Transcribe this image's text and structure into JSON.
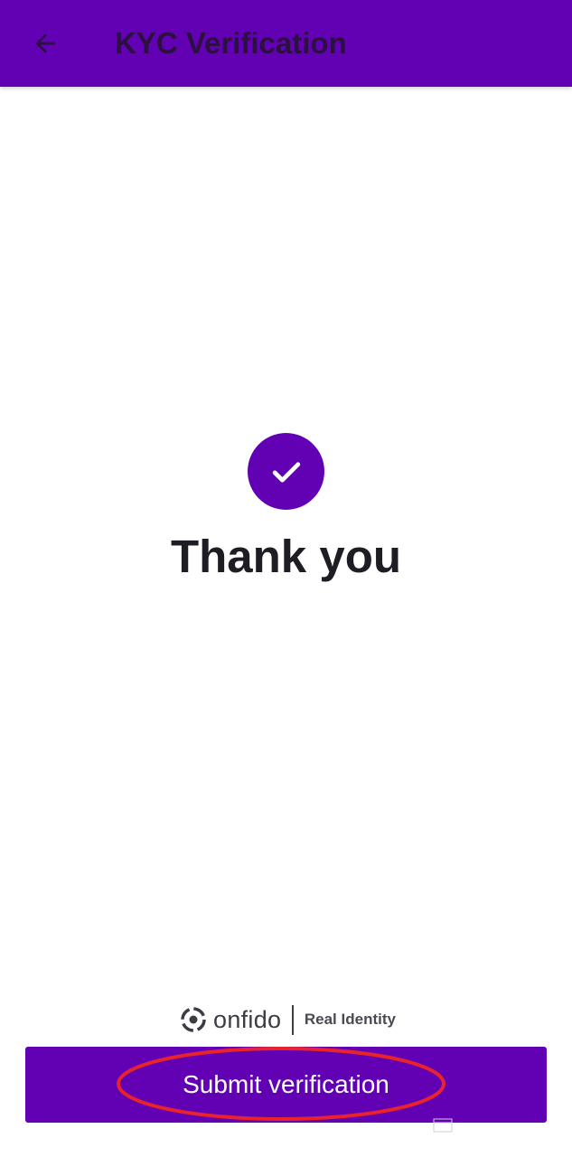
{
  "header": {
    "title": "KYC Verification",
    "back_icon": "arrow-left-icon"
  },
  "main": {
    "status_icon": "checkmark-icon",
    "message": "Thank you"
  },
  "branding": {
    "logo_icon": "onfido-logo-icon",
    "name": "onfido",
    "tagline": "Real Identity"
  },
  "footer": {
    "submit_label": "Submit verification"
  },
  "colors": {
    "primary": "#6200b4",
    "annotation": "#e8232b",
    "text": "#1f1d24"
  }
}
